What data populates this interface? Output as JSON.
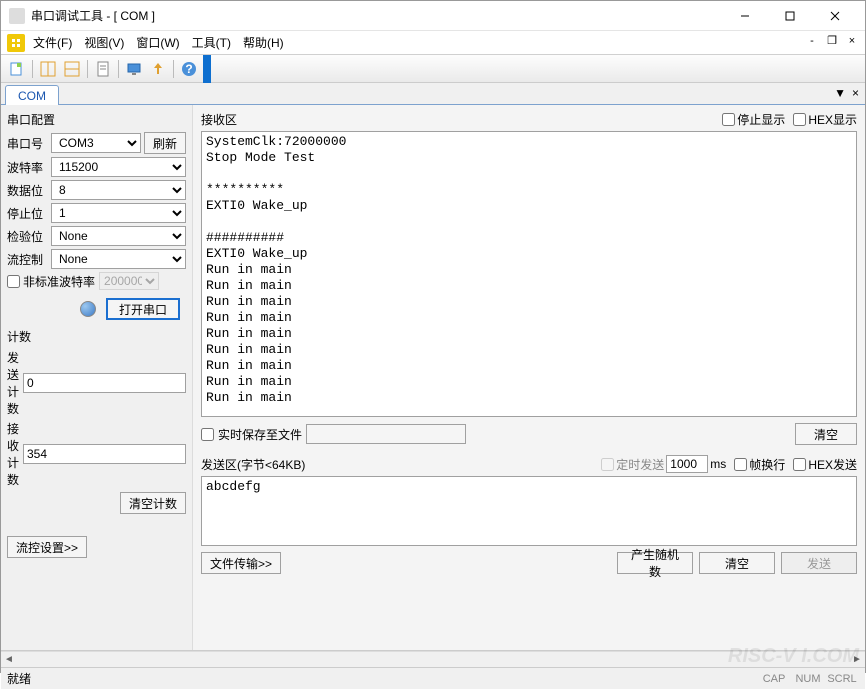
{
  "window": {
    "title": "串口调试工具 - [ COM ]"
  },
  "menu": {
    "file": "文件(F)",
    "view": "视图(V)",
    "window": "窗口(W)",
    "tools": "工具(T)",
    "help": "帮助(H)"
  },
  "tabs": {
    "tab1": "COM",
    "pin": "▼",
    "close": "×"
  },
  "config": {
    "group_title": "串口配置",
    "port_label": "串口号",
    "port_value": "COM3",
    "refresh": "刷新",
    "baud_label": "波特率",
    "baud_value": "115200",
    "data_label": "数据位",
    "data_value": "8",
    "stop_label": "停止位",
    "stop_value": "1",
    "parity_label": "检验位",
    "parity_value": "None",
    "flow_label": "流控制",
    "flow_value": "None",
    "nonstd_label": "非标准波特率",
    "nonstd_value": "200000",
    "open_btn": "打开串口",
    "count_title": "计数",
    "tx_count_label": "发送计数",
    "tx_count_value": "0",
    "rx_count_label": "接收计数",
    "rx_count_value": "354",
    "clear_count": "清空计数",
    "flow_settings": "流控设置>>"
  },
  "rx": {
    "title": "接收区",
    "pause_label": "停止显示",
    "hex_label": "HEX显示",
    "content": "SystemClk:72000000\nStop Mode Test\n\n**********\nEXTI0 Wake_up\n\n##########\nEXTI0 Wake_up\nRun in main\nRun in main\nRun in main\nRun in main\nRun in main\nRun in main\nRun in main\nRun in main\nRun in main",
    "save_label": "实时保存至文件",
    "clear_btn": "清空"
  },
  "tx": {
    "title": "发送区(字节<64KB)",
    "timer_label": "定时发送",
    "timer_value": "1000",
    "timer_unit": "ms",
    "wrap_label": "帧换行",
    "hex_label": "HEX发送",
    "content": "abcdefg",
    "file_btn": "文件传输>>",
    "rand_btn": "产生随机数",
    "clear_btn": "清空",
    "send_btn": "发送"
  },
  "status": {
    "ready": "就绪",
    "cap": "CAP",
    "num": "NUM",
    "scrl": "SCRL"
  },
  "watermark": "RISC-V I.COM"
}
